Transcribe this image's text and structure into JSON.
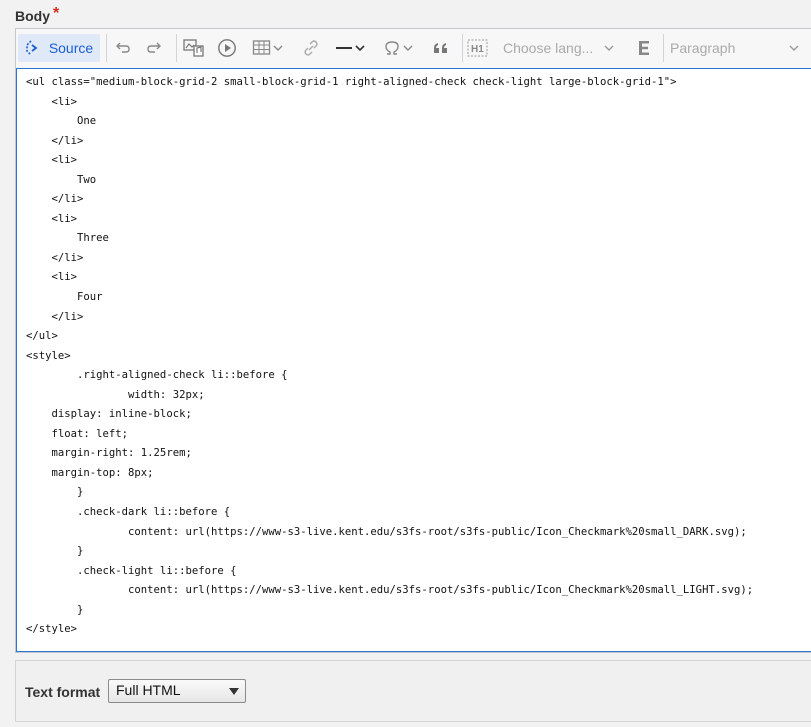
{
  "field": {
    "label": "Body",
    "required_mark": "*"
  },
  "toolbar": {
    "source_label": "Source",
    "language_placeholder": "Choose lang...",
    "paragraph_label": "Paragraph",
    "icons": [
      "source-icon",
      "undo-icon",
      "redo-icon",
      "media-icon",
      "play-icon",
      "table-icon",
      "link-icon",
      "horizontal-line-icon",
      "special-characters-icon",
      "blockquote-icon",
      "heading-h1-icon",
      "language-icon",
      "style-icon"
    ]
  },
  "source": {
    "lines": [
      "<ul class=\"medium-block-grid-2 small-block-grid-1 right-aligned-check check-light large-block-grid-1\">",
      "    <li>",
      "        One",
      "    </li>",
      "    <li>",
      "        Two",
      "    </li>",
      "    <li>",
      "        Three",
      "    </li>",
      "    <li>",
      "        Four",
      "    </li>",
      "</ul>",
      "<style>",
      "        .right-aligned-check li::before {",
      "                width: 32px;",
      "    display: inline-block;",
      "    float: left;",
      "    margin-right: 1.25rem;",
      "    margin-top: 8px;",
      "        }",
      "        .check-dark li::before {",
      "                content: url(https://www-s3-live.kent.edu/s3fs-root/s3fs-public/Icon_Checkmark%20small_DARK.svg);",
      "        }",
      "        .check-light li::before {",
      "                content: url(https://www-s3-live.kent.edu/s3fs-root/s3fs-public/Icon_Checkmark%20small_LIGHT.svg);",
      "        }",
      "</style>"
    ]
  },
  "text_format": {
    "label": "Text format",
    "selected": "Full HTML"
  },
  "colors": {
    "accent": "#2977d3",
    "required": "#d52b1e"
  }
}
